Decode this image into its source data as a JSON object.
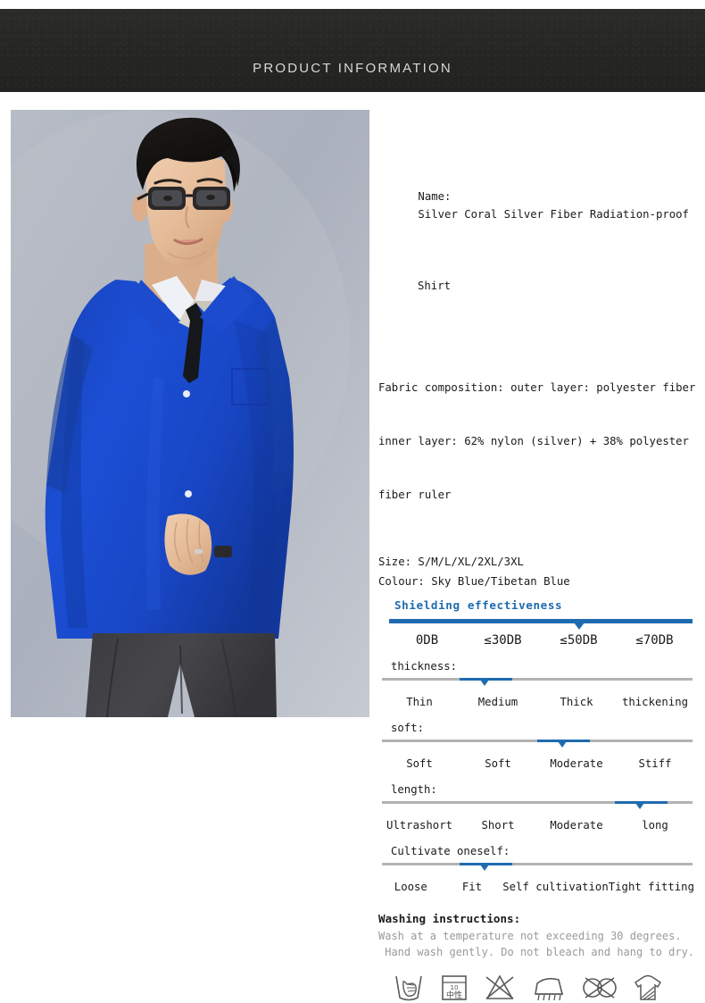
{
  "header": {
    "title": "PRODUCT INFORMATION"
  },
  "photo": {
    "alt": "model wearing blue radiation-proof shirt"
  },
  "product": {
    "name_label": "Name:",
    "name_line1": "Silver Coral Silver Fiber Radiation-proof",
    "name_line2": "Shirt",
    "fabric_line1": "Fabric composition: outer layer: polyester fiber",
    "fabric_line2": "inner layer: 62% nylon (silver) + 38% polyester",
    "fabric_line3": "fiber ruler",
    "size": "Size: S/M/L/XL/2XL/3XL",
    "colour": "Colour: Sky Blue/Tibetan Blue"
  },
  "shielding": {
    "title": "Shielding effectiveness",
    "options": [
      "0DB",
      "≤30DB",
      "≤50DB",
      "≤70DB"
    ],
    "selected_index": 2,
    "marker_percent": 62.5,
    "color": "#1f6bb0"
  },
  "scales": [
    {
      "label": "thickness:",
      "options": [
        "Thin",
        "Medium",
        "Thick",
        "thickening"
      ],
      "selected_index": 1,
      "fill_start_percent": 25,
      "fill_width_percent": 17,
      "marker_percent": 33
    },
    {
      "label": "soft:",
      "options": [
        "Soft",
        "Soft",
        "Moderate",
        "Stiff"
      ],
      "selected_index": 2,
      "fill_start_percent": 50,
      "fill_width_percent": 17,
      "marker_percent": 58
    },
    {
      "label": "length:",
      "options": [
        "Ultrashort",
        "Short",
        "Moderate",
        "long"
      ],
      "selected_index": 3,
      "fill_start_percent": 75,
      "fill_width_percent": 17,
      "marker_percent": 83
    },
    {
      "label": "Cultivate oneself:",
      "options": [
        "Loose",
        "Fit",
        "Self cultivation",
        "Tight fitting"
      ],
      "selected_index": 1,
      "fill_start_percent": 25,
      "fill_width_percent": 17,
      "marker_percent": 33
    }
  ],
  "washing": {
    "title": "Washing instructions:",
    "line1": "Wash at a temperature not exceeding 30 degrees.",
    "line2": " Hand wash gently. Do not bleach and hang to dry.",
    "icons": [
      {
        "name": "hand-wash-icon",
        "caption": ""
      },
      {
        "name": "neutral-detergent-icon",
        "caption": "10",
        "caption2": "中性"
      },
      {
        "name": "do-not-bleach-icon",
        "caption": ""
      },
      {
        "name": "iron-icon",
        "caption": ""
      },
      {
        "name": "do-not-dry-clean-icon",
        "caption": ""
      },
      {
        "name": "hang-dry-icon",
        "caption": ""
      }
    ]
  }
}
